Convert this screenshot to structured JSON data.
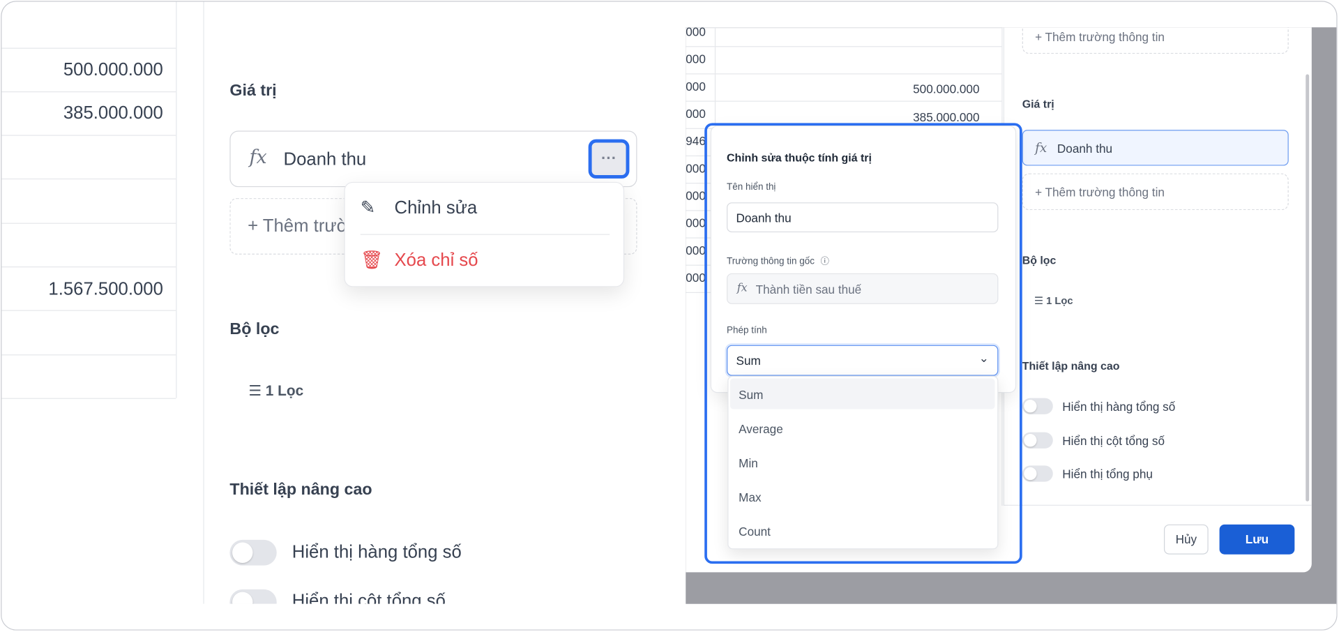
{
  "left_panel": {
    "table_values": [
      "500.000.000",
      "385.000.000",
      "1.567.500.000"
    ],
    "values_heading": "Giá trị",
    "value_field": {
      "icon": "fx-icon",
      "label": "Doanh thu",
      "more_label": "···"
    },
    "add_field_label": "Thêm trường thông tin",
    "context_menu": {
      "edit": "Chỉnh sửa",
      "delete": "Xóa chỉ số",
      "delete_color": "#e5484d"
    },
    "filter_heading": "Bộ lọc",
    "filter_label": "1 Lọc",
    "advanced_heading": "Thiết lập nâng cao",
    "toggles": [
      "Hiển thị hàng tổng số",
      "Hiển thị cột tổng số"
    ]
  },
  "right_panel": {
    "table_partial": [
      "000",
      "000",
      "000",
      "000",
      "946",
      "000",
      "000",
      "000",
      "000",
      "000"
    ],
    "table_values": [
      "500.000.000",
      "385.000.000"
    ],
    "add_field_label": "Thêm trường thông tin",
    "values_heading": "Giá trị",
    "value_field": "Doanh thu",
    "filter_heading": "Bộ lọc",
    "filter_label": "1 Lọc",
    "advanced_heading": "Thiết lập nâng cao",
    "toggles": [
      "Hiển thị hàng tổng số",
      "Hiển thị cột tổng số",
      "Hiển thị tổng phụ"
    ],
    "cancel_label": "Hủy",
    "save_label": "Lưu",
    "accent": "#1a5fd6",
    "popup": {
      "title": "Chỉnh sửa thuộc tính giá trị",
      "display_name_label": "Tên hiển thị",
      "display_name_value": "Doanh thu",
      "source_label": "Trường thông tin gốc",
      "source_value": "Thành tiền sau thuế",
      "calc_label": "Phép tính",
      "calc_value": "Sum",
      "options": [
        "Sum",
        "Average",
        "Min",
        "Max",
        "Count"
      ]
    }
  },
  "highlight_color": "#2b6ef0"
}
